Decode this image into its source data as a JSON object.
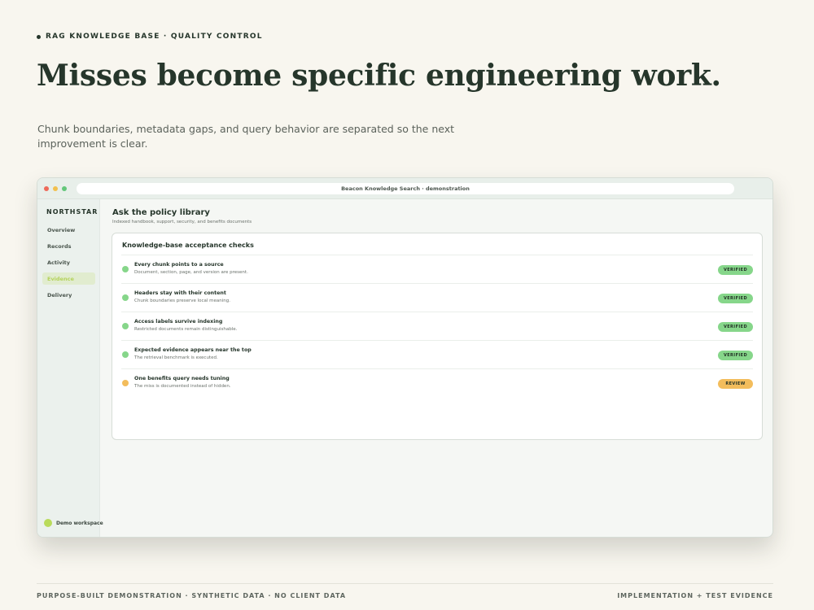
{
  "slide": {
    "eyebrow": "RAG KNOWLEDGE BASE · QUALITY CONTROL",
    "headline": "Misses become specific engineering work.",
    "lede": "Chunk boundaries, metadata gaps, and query behavior are separated so the next improvement is clear.",
    "footer_left": "PURPOSE-BUILT DEMONSTRATION · SYNTHETIC DATA · NO CLIENT DATA",
    "footer_right": "IMPLEMENTATION + TEST EVIDENCE"
  },
  "window": {
    "url": "Beacon Knowledge Search · demonstration"
  },
  "sidebar": {
    "brand": "NORTHSTAR",
    "items": [
      {
        "label": "Overview",
        "active": false
      },
      {
        "label": "Records",
        "active": false
      },
      {
        "label": "Activity",
        "active": false
      },
      {
        "label": "Evidence",
        "active": true
      },
      {
        "label": "Delivery",
        "active": false
      }
    ],
    "workspace": "Demo workspace"
  },
  "main": {
    "title": "Ask the policy library",
    "subtitle": "Indexed handbook, support, security, and benefits documents",
    "card_title": "Knowledge-base acceptance checks",
    "checks": [
      {
        "title": "Every chunk points to a source",
        "desc": "Document, section, page, and version are present.",
        "status": "VERIFIED"
      },
      {
        "title": "Headers stay with their content",
        "desc": "Chunk boundaries preserve local meaning.",
        "status": "VERIFIED"
      },
      {
        "title": "Access labels survive indexing",
        "desc": "Restricted documents remain distinguishable.",
        "status": "VERIFIED"
      },
      {
        "title": "Expected evidence appears near the top",
        "desc": "The retrieval benchmark is executed.",
        "status": "VERIFIED"
      },
      {
        "title": "One benefits query needs tuning",
        "desc": "The miss is documented instead of hidden.",
        "status": "REVIEW"
      }
    ]
  },
  "colors": {
    "background": "#f8f6ef",
    "ink": "#26362b",
    "verified": "#86d68a",
    "review": "#f3bd5c",
    "accent": "#b9db5b"
  }
}
